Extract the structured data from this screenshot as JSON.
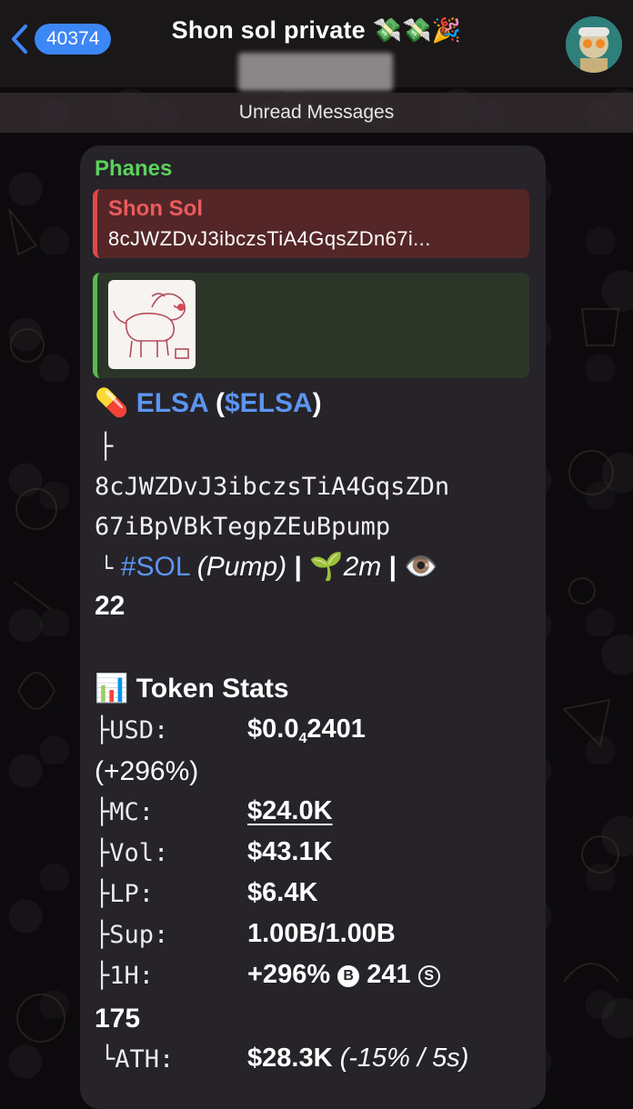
{
  "header": {
    "back_count": "40374",
    "title": "Shon sol private",
    "title_emojis": "💸💸🎉"
  },
  "unread_label": "Unread Messages",
  "message": {
    "sender": "Phanes",
    "reply": {
      "name": "Shon Sol",
      "text": "8cJWZDvJ3ibczsTiA4GqsZDn67i..."
    },
    "token_icon": "💊",
    "token_name": "ELSA",
    "token_symbol": "$ELSA",
    "tree_branch": "├",
    "address_line1": "8cJWZDvJ3ibczsTiA4GqsZDn",
    "address_line2": "67iBpVBkTegpZEuBpump",
    "tree_end": "└",
    "chain_tag": "#SOL",
    "platform": "(Pump)",
    "separator": "|",
    "age_icon": "🌱",
    "age": "2m",
    "views_icon": "👁️",
    "views": "22",
    "stats_icon": "📊",
    "stats_title": "Token Stats",
    "stats": {
      "usd_key": "├USD:",
      "usd_prefix": "$0.0",
      "usd_sub": "4",
      "usd_rest": "2401",
      "usd_change": "(+296%)",
      "mc_key": "├MC:",
      "mc_val": "$24.0K",
      "vol_key": "├Vol:",
      "vol_val": "$43.1K",
      "lp_key": "├LP:",
      "lp_val": "$6.4K",
      "sup_key": "├Sup:",
      "sup_val": "1.00B/1.00B",
      "h1_key": "├1H:",
      "h1_pct": "+296%",
      "h1_buy_icon": "B",
      "h1_buys": "241",
      "h1_sell_icon": "S",
      "h1_sells": "175",
      "ath_key": "└ATH:",
      "ath_val": "$28.3K",
      "ath_note": "(-15% / 5s)"
    }
  },
  "colors": {
    "accent": "#3d86f6",
    "sender": "#5cd15c",
    "reply_name": "#ec5a5d",
    "link": "#5c95f2",
    "bubble": "#262329"
  }
}
